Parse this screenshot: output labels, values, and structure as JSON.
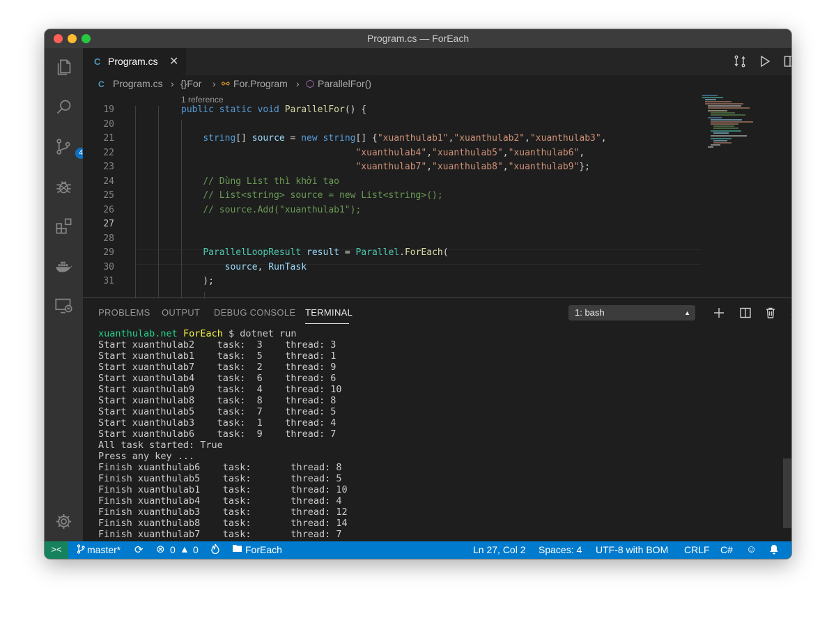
{
  "window": {
    "title": "Program.cs — ForEach"
  },
  "activity_bar": {
    "scm_badge": "4",
    "icons": [
      "explorer-icon",
      "search-icon",
      "source-control-icon",
      "debug-icon",
      "extensions-icon",
      "docker-icon",
      "remote-explorer-icon",
      "settings-gear-icon"
    ]
  },
  "tab": {
    "label": "Program.cs",
    "lang_glyph": "C#"
  },
  "breadcrumbs": {
    "file": "Program.cs",
    "namespace": "{}For",
    "class": "For.Program",
    "method": "ParallelFor()"
  },
  "editor": {
    "codelens": "1 reference",
    "active_line": "27",
    "lines": [
      {
        "n": "19",
        "tokens": [
          {
            "t": "public static void ",
            "c": "kw"
          },
          {
            "t": "ParallelFor",
            "c": "fn"
          },
          {
            "t": "() {",
            "c": "pl"
          }
        ]
      },
      {
        "n": "20",
        "tokens": []
      },
      {
        "n": "21",
        "tokens": [
          {
            "t": "    ",
            "c": "pl"
          },
          {
            "t": "string",
            "c": "kw"
          },
          {
            "t": "[] ",
            "c": "pl"
          },
          {
            "t": "source",
            "c": "var"
          },
          {
            "t": " = ",
            "c": "pl"
          },
          {
            "t": "new ",
            "c": "kw"
          },
          {
            "t": "string",
            "c": "kw"
          },
          {
            "t": "[] {",
            "c": "pl"
          },
          {
            "t": "\"xuanthulab1\"",
            "c": "str"
          },
          {
            "t": ",",
            "c": "pl"
          },
          {
            "t": "\"xuanthulab2\"",
            "c": "str"
          },
          {
            "t": ",",
            "c": "pl"
          },
          {
            "t": "\"xuanthulab3\"",
            "c": "str"
          },
          {
            "t": ",",
            "c": "pl"
          }
        ]
      },
      {
        "n": "22",
        "tokens": [
          {
            "t": "                                ",
            "c": "pl"
          },
          {
            "t": "\"xuanthulab4\"",
            "c": "str"
          },
          {
            "t": ",",
            "c": "pl"
          },
          {
            "t": "\"xuanthulab5\"",
            "c": "str"
          },
          {
            "t": ",",
            "c": "pl"
          },
          {
            "t": "\"xuanthulab6\"",
            "c": "str"
          },
          {
            "t": ",",
            "c": "pl"
          }
        ]
      },
      {
        "n": "23",
        "tokens": [
          {
            "t": "                                ",
            "c": "pl"
          },
          {
            "t": "\"xuanthulab7\"",
            "c": "str"
          },
          {
            "t": ",",
            "c": "pl"
          },
          {
            "t": "\"xuanthulab8\"",
            "c": "str"
          },
          {
            "t": ",",
            "c": "pl"
          },
          {
            "t": "\"xuanthulab9\"",
            "c": "str"
          },
          {
            "t": "};",
            "c": "pl"
          }
        ]
      },
      {
        "n": "24",
        "tokens": [
          {
            "t": "    ",
            "c": "pl"
          },
          {
            "t": "// Dùng List thì khởi tạo",
            "c": "cmt"
          }
        ]
      },
      {
        "n": "25",
        "tokens": [
          {
            "t": "    ",
            "c": "pl"
          },
          {
            "t": "// List<string> source = new List<string>();",
            "c": "cmt"
          }
        ]
      },
      {
        "n": "26",
        "tokens": [
          {
            "t": "    ",
            "c": "pl"
          },
          {
            "t": "// source.Add(\"xuanthulab1\");",
            "c": "cmt"
          }
        ]
      },
      {
        "n": "27",
        "tokens": []
      },
      {
        "n": "28",
        "tokens": []
      },
      {
        "n": "29",
        "tokens": [
          {
            "t": "    ",
            "c": "pl"
          },
          {
            "t": "ParallelLoopResult",
            "c": "type"
          },
          {
            "t": " ",
            "c": "pl"
          },
          {
            "t": "result",
            "c": "var"
          },
          {
            "t": " = ",
            "c": "pl"
          },
          {
            "t": "Parallel",
            "c": "type"
          },
          {
            "t": ".",
            "c": "pl"
          },
          {
            "t": "ForEach",
            "c": "fn"
          },
          {
            "t": "(",
            "c": "pl"
          }
        ]
      },
      {
        "n": "30",
        "tokens": [
          {
            "t": "        ",
            "c": "pl"
          },
          {
            "t": "source",
            "c": "var"
          },
          {
            "t": ", ",
            "c": "pl"
          },
          {
            "t": "RunTask",
            "c": "var"
          }
        ]
      },
      {
        "n": "31",
        "tokens": [
          {
            "t": "    );",
            "c": "pl"
          }
        ]
      }
    ]
  },
  "panel": {
    "tabs": [
      "PROBLEMS",
      "OUTPUT",
      "DEBUG CONSOLE",
      "TERMINAL"
    ],
    "active_tab": "TERMINAL",
    "terminal_select": "1: bash",
    "prompt": {
      "host": "xuanthulab.net",
      "dir": "ForEach",
      "cmd": " $ dotnet run"
    },
    "output": [
      "Start xuanthulab2    task:  3    thread: 3",
      "Start xuanthulab1    task:  5    thread: 1",
      "Start xuanthulab7    task:  2    thread: 9",
      "Start xuanthulab4    task:  6    thread: 6",
      "Start xuanthulab9    task:  4    thread: 10",
      "Start xuanthulab8    task:  8    thread: 8",
      "Start xuanthulab5    task:  7    thread: 5",
      "Start xuanthulab3    task:  1    thread: 4",
      "Start xuanthulab6    task:  9    thread: 7",
      "All task started: True",
      "Press any key ...",
      "Finish xuanthulab6    task:       thread: 8",
      "Finish xuanthulab5    task:       thread: 5",
      "Finish xuanthulab1    task:       thread: 10",
      "Finish xuanthulab4    task:       thread: 4",
      "Finish xuanthulab3    task:       thread: 12",
      "Finish xuanthulab8    task:       thread: 14",
      "Finish xuanthulab7    task:       thread: 7"
    ]
  },
  "status": {
    "remote": "><",
    "branch": "master*",
    "errors": "0",
    "warnings": "0",
    "folder": "ForEach",
    "position": "Ln 27, Col 2",
    "spaces": "Spaces: 4",
    "encoding": "UTF-8 with BOM",
    "eol": "CRLF",
    "language": "C#"
  },
  "colors": {
    "accent": "#007acc",
    "remote": "#16825d",
    "editor_bg": "#1e1e1e"
  }
}
